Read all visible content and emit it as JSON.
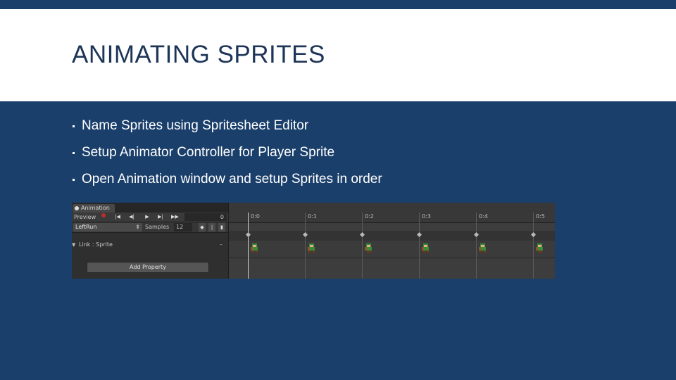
{
  "slide": {
    "title": "ANIMATING SPRITES",
    "bullets": [
      "Name Sprites using Spritesheet Editor",
      "Setup Animator Controller for Player Sprite",
      "Open Animation window and setup Sprites in order"
    ]
  },
  "animation_window": {
    "tab_label": "Animation",
    "toolbar": {
      "preview_label": "Preview",
      "frame_value": "0"
    },
    "clip": {
      "name": "LeftRun",
      "samples_label": "Samples",
      "samples_value": "12"
    },
    "property": {
      "name": "Link : Sprite"
    },
    "add_property_label": "Add Property",
    "timeline_ticks": [
      "0:0",
      "0:1",
      "0:2",
      "0:3",
      "0:4",
      "0:5"
    ]
  },
  "colors": {
    "background": "#1a3f6b",
    "title_band": "#ffffff",
    "title_text": "#1d3557",
    "record": "#c02c2c"
  }
}
